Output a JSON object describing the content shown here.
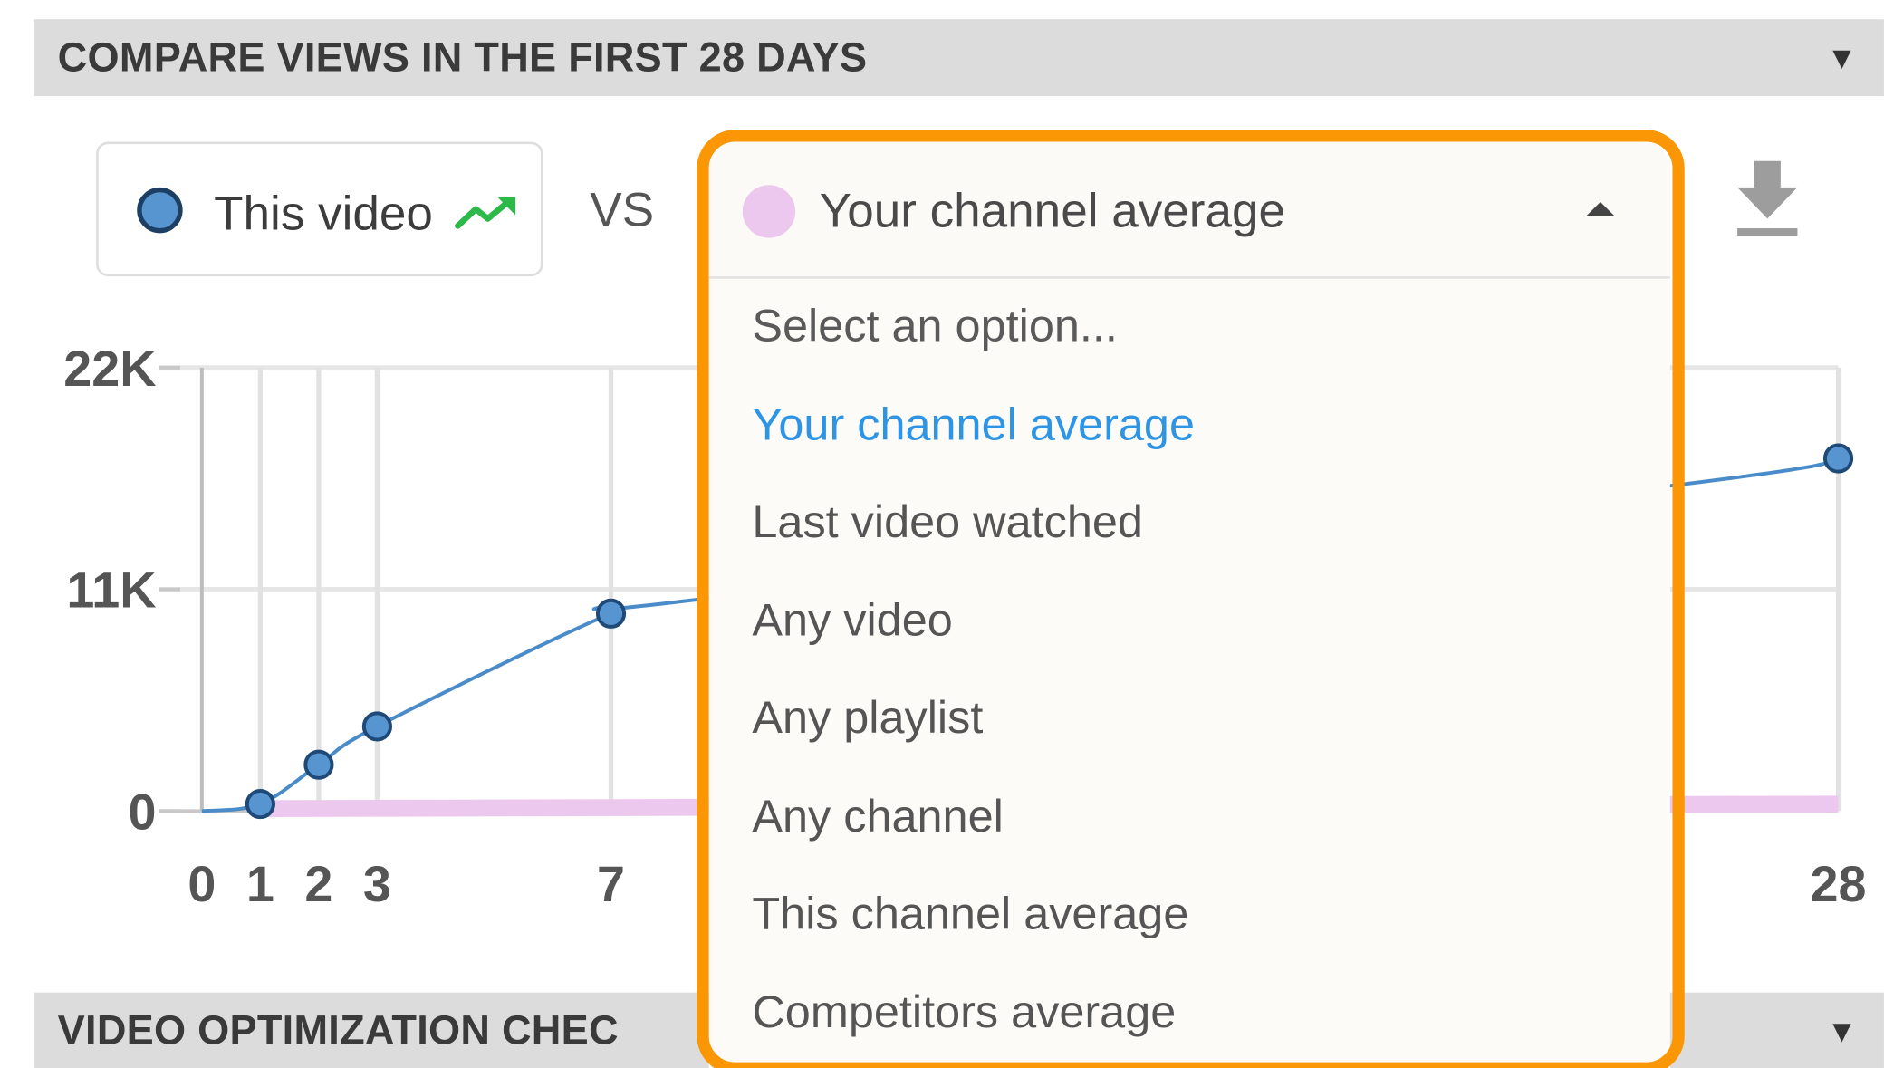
{
  "sections": {
    "compare_header": "COMPARE VIEWS IN THE FIRST 28 DAYS",
    "optimization_header": "VIDEO OPTIMIZATION CHEC",
    "caret_icon": "caret-down-icon"
  },
  "comparison": {
    "primary_label": "This video",
    "primary_color": "#5795d0",
    "trend_icon": "trending-up-icon",
    "trend_color": "#2db84a",
    "vs_label": "VS",
    "download_icon": "download-icon"
  },
  "dropdown": {
    "selected_value": "Your channel average",
    "selected_color": "#ecc8ee",
    "highlight_color": "#fb9704",
    "expanded": true,
    "options": [
      "Select an option...",
      "Your channel average",
      "Last video watched",
      "Any video",
      "Any playlist",
      "Any channel",
      "This channel average",
      "Competitors average"
    ],
    "selected_index": 1
  },
  "chart_data": {
    "type": "line",
    "title": "",
    "xlabel": "",
    "ylabel": "",
    "ylim": [
      0,
      22000
    ],
    "xlim": [
      0,
      28
    ],
    "yticks": [
      {
        "value": 0,
        "label": "0"
      },
      {
        "value": 11000,
        "label": "11K"
      },
      {
        "value": 22000,
        "label": "22K"
      }
    ],
    "xticks": [
      {
        "value": 0,
        "label": "0"
      },
      {
        "value": 1,
        "label": "1"
      },
      {
        "value": 2,
        "label": "2"
      },
      {
        "value": 3,
        "label": "3"
      },
      {
        "value": 7,
        "label": "7"
      },
      {
        "value": 28,
        "label": "28"
      }
    ],
    "grid": true,
    "series": [
      {
        "name": "This video",
        "color": "#5795d0",
        "line_color": "#4a8bc9",
        "points": [
          {
            "x": 0,
            "y": 0,
            "marker": false
          },
          {
            "x": 1,
            "y": 350,
            "marker": true
          },
          {
            "x": 2,
            "y": 2300,
            "marker": true
          },
          {
            "x": 3,
            "y": 4200,
            "marker": true
          },
          {
            "x": 7,
            "y": 9800,
            "marker": true
          },
          {
            "x": 8.2,
            "y": 10400,
            "marker": false
          },
          {
            "x": 25.3,
            "y": 16200,
            "marker": false
          },
          {
            "x": 28,
            "y": 17500,
            "marker": true
          }
        ]
      },
      {
        "name": "Your channel average",
        "color": "#ecc8ee",
        "points": [
          {
            "x": 1,
            "y": 120
          },
          {
            "x": 28,
            "y": 350
          }
        ]
      }
    ]
  }
}
